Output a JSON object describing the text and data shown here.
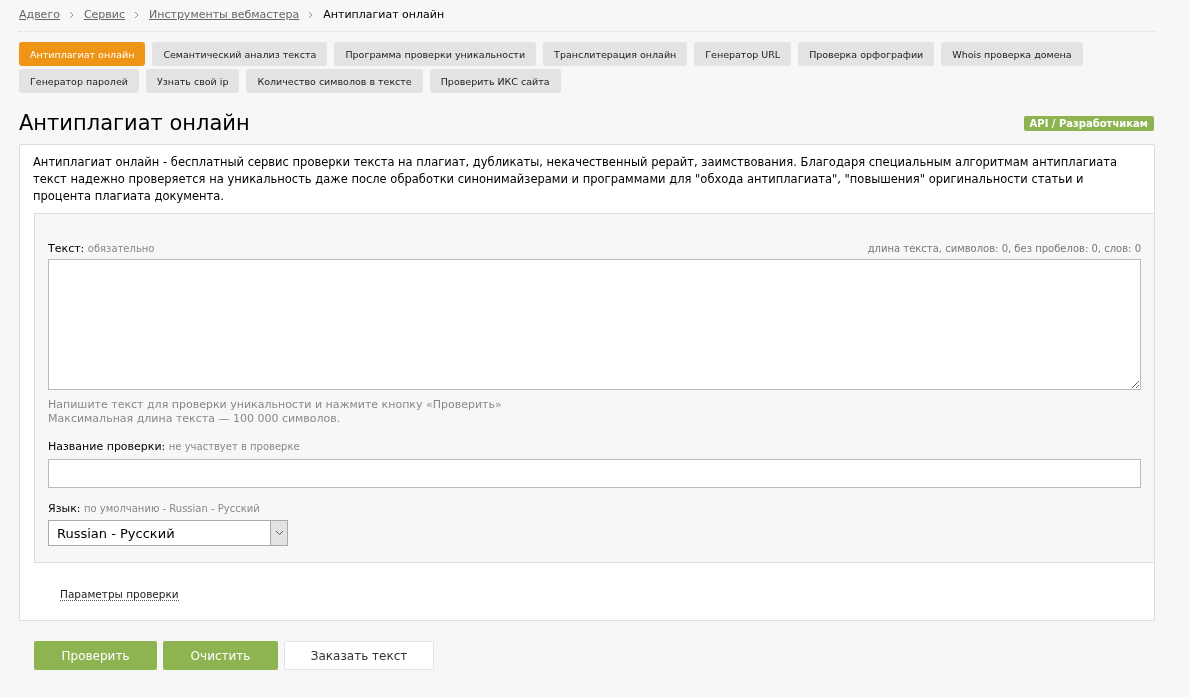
{
  "breadcrumbs": [
    {
      "label": "Адвего",
      "link": true
    },
    {
      "label": "Сервис",
      "link": true
    },
    {
      "label": "Инструменты вебмастера",
      "link": true
    },
    {
      "label": "Антиплагиат онлайн",
      "link": false
    }
  ],
  "tabs": [
    {
      "label": "Антиплагиат онлайн",
      "selected": true
    },
    {
      "label": "Семантический анализ текста",
      "selected": false
    },
    {
      "label": "Программа проверки уникальности",
      "selected": false
    },
    {
      "label": "Транслитерация онлайн",
      "selected": false
    },
    {
      "label": "Генератор URL",
      "selected": false
    },
    {
      "label": "Проверка орфографии",
      "selected": false
    },
    {
      "label": "Whois проверка домена",
      "selected": false
    },
    {
      "label": "Генератор паролей",
      "selected": false
    },
    {
      "label": "Узнать свой ip",
      "selected": false
    },
    {
      "label": "Количество символов в тексте",
      "selected": false
    },
    {
      "label": "Проверить ИКС сайта",
      "selected": false
    }
  ],
  "title": "Антиплагиат онлайн",
  "api_badge": "API / Разработчикам",
  "description": "Антиплагиат онлайн - бесплатный сервис проверки текста на плагиат, дубликаты, некачественный рерайт, заимствования. Благодаря специальным алгоритмам антиплагиата текст надежно проверяется на уникальность даже после обработки синонимайзерами и программами для \"обхода антиплагиата\", \"повышения\" оригинальности статьи и процента плагиата документа.",
  "text_field": {
    "label": "Текст:",
    "note": "обязательно",
    "stats": "длина текста, символов: 0, без пробелов: 0, слов: 0",
    "hints": [
      "Напишите текст для проверки уникальности и нажмите кнопку «Проверить»",
      "Максимальная длина текста — 100 000 символов."
    ]
  },
  "name_field": {
    "label": "Название проверки:",
    "note": "не участвует в проверке"
  },
  "language_field": {
    "label": "Язык:",
    "note": "по умолчанию - Russian - Русский",
    "value": "Russian - Русский"
  },
  "params_link": "Параметры проверки",
  "buttons": [
    {
      "label": "Проверить",
      "kind": "primary"
    },
    {
      "label": "Очистить",
      "kind": "primary"
    },
    {
      "label": "Заказать текст",
      "kind": "plain"
    }
  ]
}
